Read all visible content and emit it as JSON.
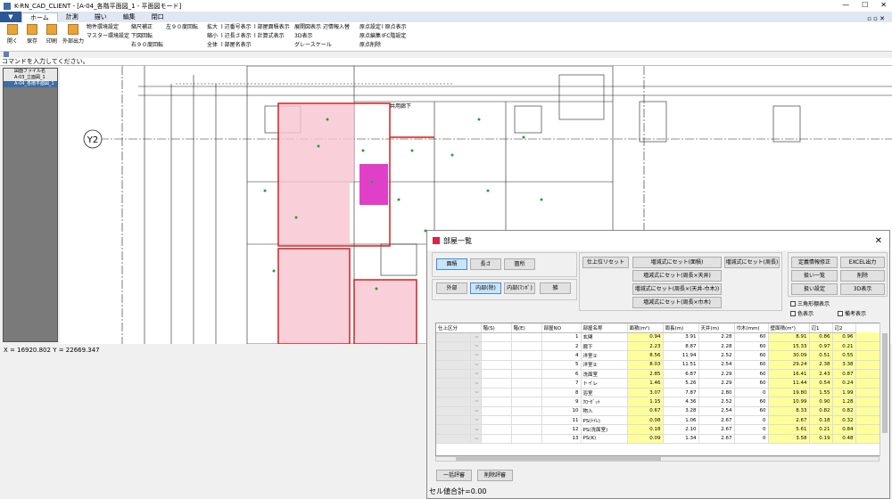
{
  "window": {
    "title": "K-RN_CAD_CLIENT - [A-04_各階平面図_1 - 平面図モード]",
    "minimize": "—",
    "maximize": "☐",
    "close": "✕"
  },
  "ribbon_tabs": {
    "file": "▼",
    "tabs": [
      "ホーム",
      "計測",
      "描い",
      "編集",
      "閉口"
    ],
    "right_controls": "▫ ▫ ✕"
  },
  "ribbon": {
    "big_buttons": [
      "開く",
      "保存",
      "印刷",
      "外部出力"
    ],
    "col1": [
      "物件環境設定",
      "マスター環境設定"
    ],
    "col2": [
      "縮尺補正",
      "下図回転",
      "右９０度回転"
    ],
    "col3": [
      "左９０度回転"
    ],
    "col4": [
      "拡大",
      "縮小",
      "全体"
    ],
    "col5": [
      "辺番号表示",
      "辺長さ表示",
      "部屋名表示"
    ],
    "col6": [
      "部屋面積表示",
      "計算式表示"
    ],
    "col7": [
      "展開図表示",
      "3D表示",
      "グレースケール"
    ],
    "col8": [
      "辺情報入替"
    ],
    "col9": [
      "原点設定",
      "原点編集",
      "原点削除"
    ],
    "col10": [
      "原点表示",
      "IFC階設定"
    ]
  },
  "command_prompt": "コマンドを入力してください。",
  "side_panel": {
    "header": "図面ファイル名",
    "files": [
      "A-03_立面図_1",
      "A-04_各階平面図_1"
    ]
  },
  "cad": {
    "grid_label": "Y2",
    "room_label": "共用廊下"
  },
  "coords": "X = 16920.802 Y = 22669.347",
  "dialog": {
    "title": "部屋一覧",
    "close": "✕",
    "mode_buttons": [
      "面積",
      "長さ",
      "箇所"
    ],
    "part_buttons": [
      "外部",
      "内部(除)",
      "内部(ﾏﾝﾎﾞ)",
      "雑"
    ],
    "calc_buttons": {
      "finish_reset": "仕上位リセット",
      "reset_area": "増減式にセット(面積)",
      "reset_perimeter": "増減式にセット(周長)",
      "reset_perimeter_ceiling": "増減式にセット(周長×天井)",
      "reset_perimeter_ceiling_baseboard": "増減式にセット(周長×(天井-巾木))",
      "reset_perimeter_baseboard": "増減式にセット(周長×巾木)"
    },
    "right_buttons": {
      "fixed_info": "定義情報修正",
      "excel_out": "EXCEL出力",
      "list": "扱い一覧",
      "delete": "削除",
      "settings": "扱い設定",
      "view3d": "3D表示"
    },
    "checkboxes": {
      "triangle": "三角形棚表示",
      "color": "色表示",
      "remarks": "備考表示"
    },
    "columns": [
      "仕上区分",
      "階(S)",
      "階(E)",
      "部屋NO",
      "部屋名称",
      "面積(m²)",
      "周長(m)",
      "天井(m)",
      "巾木(mm)",
      "壁面積(m²)",
      "辺1",
      "辺2"
    ],
    "rows": [
      [
        "1",
        "玄関",
        "0.94",
        "3.91",
        "2.28",
        "60",
        "8.91",
        "0.86",
        "0.96"
      ],
      [
        "2",
        "廊下",
        "2.23",
        "8.87",
        "2.28",
        "60",
        "15.33",
        "0.97",
        "0.21"
      ],
      [
        "4",
        "洋室①",
        "8.56",
        "11.94",
        "2.52",
        "60",
        "30.09",
        "0.51",
        "0.55"
      ],
      [
        "5",
        "洋室②",
        "8.03",
        "11.51",
        "2.54",
        "60",
        "29.24",
        "2.38",
        "3.38"
      ],
      [
        "6",
        "洗面室",
        "2.85",
        "6.87",
        "2.29",
        "60",
        "16.41",
        "2.43",
        "0.87"
      ],
      [
        "7",
        "トイレ",
        "1.46",
        "5.26",
        "2.29",
        "60",
        "11.44",
        "0.54",
        "0.24"
      ],
      [
        "8",
        "浴室",
        "3.07",
        "7.87",
        "2.80",
        "0",
        "19.80",
        "1.55",
        "1.99"
      ],
      [
        "9",
        "ｸﾛｰｾﾞｯﾄ",
        "1.15",
        "4.36",
        "2.52",
        "60",
        "10.99",
        "0.90",
        "1.28"
      ],
      [
        "10",
        "物入",
        "0.67",
        "3.28",
        "2.54",
        "60",
        "8.33",
        "0.82",
        "0.82"
      ],
      [
        "11",
        "PS(ﾄｲﾚ)",
        "0.08",
        "1.06",
        "2.67",
        "0",
        "2.67",
        "0.18",
        "0.32"
      ],
      [
        "12",
        "PS(洗面室)",
        "0.18",
        "2.10",
        "2.67",
        "0",
        "5.61",
        "0.21",
        "0.84"
      ],
      [
        "13",
        "PS(K)",
        "0.09",
        "1.34",
        "2.67",
        "0",
        "3.58",
        "0.19",
        "0.48"
      ]
    ],
    "bottom_buttons": [
      "一括評審",
      "削除評審"
    ],
    "cell_total": "セル値合計=0.00"
  },
  "colors": {
    "ribbon_file_tab": "#2b5797",
    "highlight_room": "#e040c8",
    "room_fill": "#f5b8c8",
    "yellow_cell": "#ffff99"
  }
}
